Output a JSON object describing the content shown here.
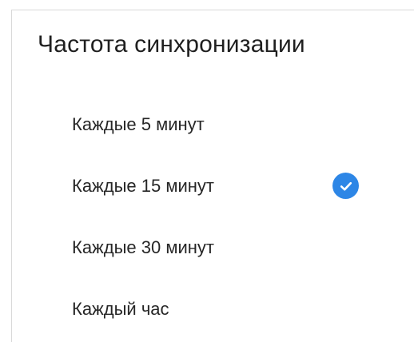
{
  "dialog": {
    "title": "Частота синхронизации",
    "options": [
      {
        "label": "Каждые 5 минут",
        "selected": false
      },
      {
        "label": "Каждые 15 минут",
        "selected": true
      },
      {
        "label": "Каждые 30 минут",
        "selected": false
      },
      {
        "label": "Каждый час",
        "selected": false
      }
    ],
    "selected_icon": "check-circle-icon"
  },
  "colors": {
    "accent": "#2d86e6",
    "text": "#262626",
    "background": "#ffffff"
  }
}
